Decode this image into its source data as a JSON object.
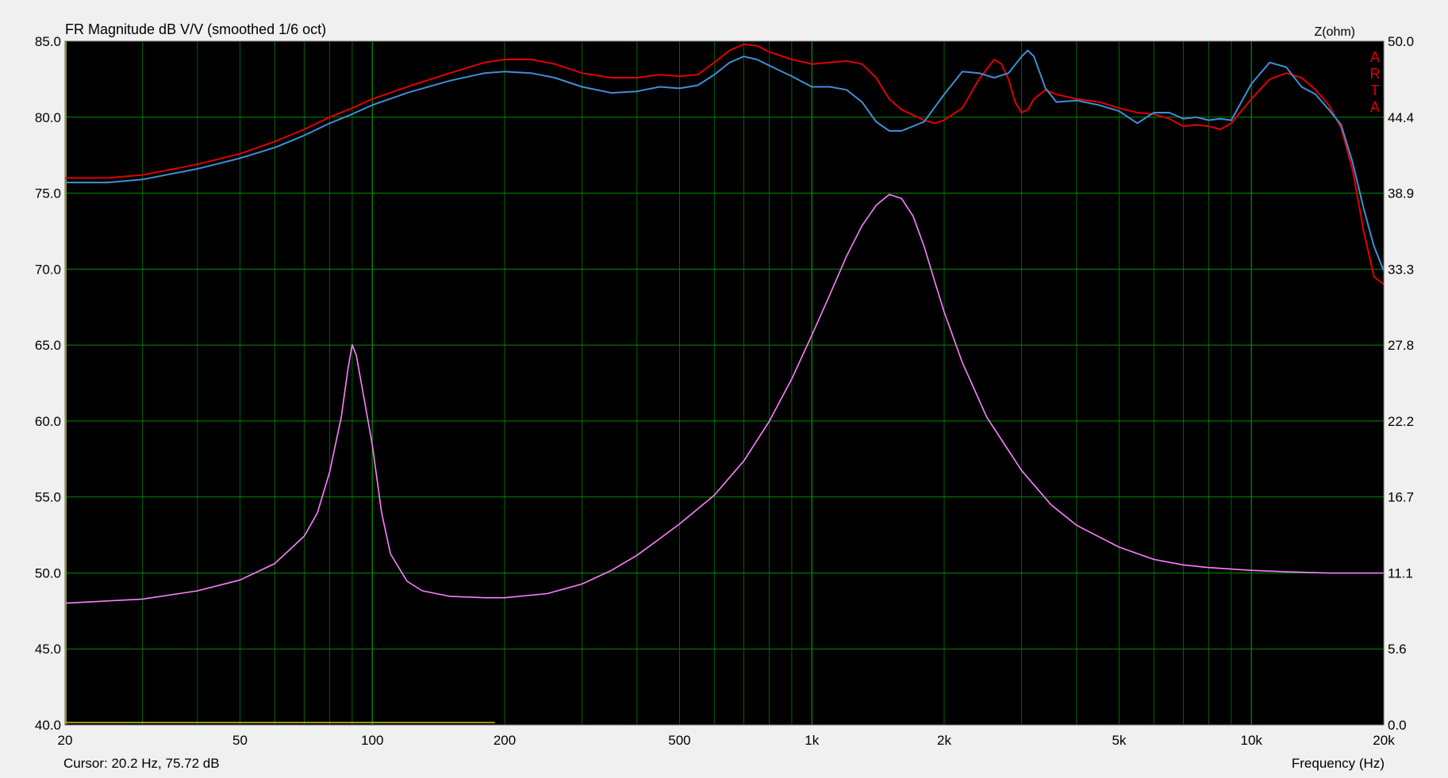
{
  "chart_data": {
    "type": "line",
    "title": "FR Magnitude dB V/V (smoothed 1/6 oct)",
    "xlabel": "Frequency (Hz)",
    "ylabel_left": "",
    "ylabel_right": "Z(ohm)",
    "watermark": "ARTA",
    "cursor_readout": "Cursor: 20.2 Hz, 75.72 dB",
    "x_scale": "log",
    "xlim": [
      20,
      20000
    ],
    "ylim_left": [
      40,
      85
    ],
    "ylim_right": [
      0,
      50
    ],
    "grid": true,
    "x_ticks": [
      {
        "value": 20,
        "label": "20"
      },
      {
        "value": 50,
        "label": "50"
      },
      {
        "value": 100,
        "label": "100"
      },
      {
        "value": 200,
        "label": "200"
      },
      {
        "value": 500,
        "label": "500"
      },
      {
        "value": 1000,
        "label": "1k"
      },
      {
        "value": 2000,
        "label": "2k"
      },
      {
        "value": 5000,
        "label": "5k"
      },
      {
        "value": 10000,
        "label": "10k"
      },
      {
        "value": 20000,
        "label": "20k"
      }
    ],
    "y_left_ticks": [
      "40.0",
      "45.0",
      "50.0",
      "55.0",
      "60.0",
      "65.0",
      "70.0",
      "75.0",
      "80.0",
      "85.0"
    ],
    "y_right_ticks": [
      "0.0",
      "5.6",
      "11.1",
      "16.7",
      "22.2",
      "27.8",
      "33.3",
      "38.9",
      "44.4",
      "50.0"
    ],
    "series": [
      {
        "axis": "left",
        "color": "#e00000",
        "points": [
          [
            20,
            76.0
          ],
          [
            25,
            76.0
          ],
          [
            30,
            76.2
          ],
          [
            40,
            76.9
          ],
          [
            50,
            77.6
          ],
          [
            60,
            78.4
          ],
          [
            70,
            79.2
          ],
          [
            80,
            80.0
          ],
          [
            90,
            80.6
          ],
          [
            100,
            81.2
          ],
          [
            120,
            82.0
          ],
          [
            150,
            82.9
          ],
          [
            180,
            83.6
          ],
          [
            200,
            83.8
          ],
          [
            230,
            83.8
          ],
          [
            260,
            83.5
          ],
          [
            300,
            82.9
          ],
          [
            350,
            82.6
          ],
          [
            400,
            82.6
          ],
          [
            450,
            82.8
          ],
          [
            500,
            82.7
          ],
          [
            550,
            82.8
          ],
          [
            600,
            83.6
          ],
          [
            650,
            84.4
          ],
          [
            700,
            84.8
          ],
          [
            750,
            84.7
          ],
          [
            800,
            84.3
          ],
          [
            900,
            83.8
          ],
          [
            1000,
            83.5
          ],
          [
            1100,
            83.6
          ],
          [
            1200,
            83.7
          ],
          [
            1300,
            83.5
          ],
          [
            1400,
            82.6
          ],
          [
            1500,
            81.2
          ],
          [
            1600,
            80.5
          ],
          [
            1800,
            79.8
          ],
          [
            1900,
            79.6
          ],
          [
            2000,
            79.8
          ],
          [
            2200,
            80.6
          ],
          [
            2400,
            82.5
          ],
          [
            2600,
            83.8
          ],
          [
            2700,
            83.5
          ],
          [
            2800,
            82.5
          ],
          [
            2900,
            81.0
          ],
          [
            3000,
            80.3
          ],
          [
            3100,
            80.5
          ],
          [
            3200,
            81.2
          ],
          [
            3400,
            81.8
          ],
          [
            3600,
            81.5
          ],
          [
            4000,
            81.2
          ],
          [
            4500,
            81.0
          ],
          [
            5000,
            80.6
          ],
          [
            5500,
            80.3
          ],
          [
            6000,
            80.2
          ],
          [
            6500,
            79.9
          ],
          [
            7000,
            79.4
          ],
          [
            7500,
            79.5
          ],
          [
            8000,
            79.4
          ],
          [
            8500,
            79.2
          ],
          [
            9000,
            79.6
          ],
          [
            10000,
            81.2
          ],
          [
            11000,
            82.5
          ],
          [
            12000,
            82.9
          ],
          [
            13000,
            82.6
          ],
          [
            14000,
            81.8
          ],
          [
            15000,
            80.8
          ],
          [
            16000,
            79.3
          ],
          [
            17000,
            76.5
          ],
          [
            18000,
            72.5
          ],
          [
            19000,
            69.5
          ],
          [
            20000,
            69.0
          ]
        ]
      },
      {
        "axis": "left",
        "color": "#3f8fd6",
        "points": [
          [
            20,
            75.7
          ],
          [
            25,
            75.7
          ],
          [
            30,
            75.9
          ],
          [
            40,
            76.6
          ],
          [
            50,
            77.3
          ],
          [
            60,
            78.0
          ],
          [
            70,
            78.8
          ],
          [
            80,
            79.6
          ],
          [
            90,
            80.2
          ],
          [
            100,
            80.8
          ],
          [
            120,
            81.6
          ],
          [
            150,
            82.4
          ],
          [
            180,
            82.9
          ],
          [
            200,
            83.0
          ],
          [
            230,
            82.9
          ],
          [
            260,
            82.6
          ],
          [
            300,
            82.0
          ],
          [
            350,
            81.6
          ],
          [
            400,
            81.7
          ],
          [
            450,
            82.0
          ],
          [
            500,
            81.9
          ],
          [
            550,
            82.1
          ],
          [
            600,
            82.8
          ],
          [
            650,
            83.6
          ],
          [
            700,
            84.0
          ],
          [
            750,
            83.8
          ],
          [
            800,
            83.4
          ],
          [
            900,
            82.7
          ],
          [
            1000,
            82.0
          ],
          [
            1100,
            82.0
          ],
          [
            1200,
            81.8
          ],
          [
            1300,
            81.0
          ],
          [
            1400,
            79.7
          ],
          [
            1500,
            79.1
          ],
          [
            1600,
            79.1
          ],
          [
            1800,
            79.7
          ],
          [
            2000,
            81.5
          ],
          [
            2200,
            83.0
          ],
          [
            2400,
            82.9
          ],
          [
            2600,
            82.6
          ],
          [
            2800,
            82.9
          ],
          [
            3000,
            84.0
          ],
          [
            3100,
            84.4
          ],
          [
            3200,
            84.0
          ],
          [
            3400,
            81.9
          ],
          [
            3600,
            81.0
          ],
          [
            4000,
            81.1
          ],
          [
            4500,
            80.8
          ],
          [
            5000,
            80.4
          ],
          [
            5500,
            79.6
          ],
          [
            6000,
            80.3
          ],
          [
            6500,
            80.3
          ],
          [
            7000,
            79.9
          ],
          [
            7500,
            80.0
          ],
          [
            8000,
            79.8
          ],
          [
            8500,
            79.9
          ],
          [
            9000,
            79.8
          ],
          [
            10000,
            82.2
          ],
          [
            11000,
            83.6
          ],
          [
            12000,
            83.3
          ],
          [
            13000,
            82.0
          ],
          [
            14000,
            81.5
          ],
          [
            15000,
            80.5
          ],
          [
            16000,
            79.5
          ],
          [
            17000,
            77.0
          ],
          [
            18000,
            74.0
          ],
          [
            19000,
            71.5
          ],
          [
            20000,
            69.9
          ]
        ]
      },
      {
        "axis": "right",
        "color": "#ff80ff",
        "points": [
          [
            20,
            8.9
          ],
          [
            30,
            9.2
          ],
          [
            40,
            9.8
          ],
          [
            50,
            10.6
          ],
          [
            60,
            11.8
          ],
          [
            70,
            13.8
          ],
          [
            75,
            15.5
          ],
          [
            80,
            18.5
          ],
          [
            85,
            22.5
          ],
          [
            88,
            26.0
          ],
          [
            90,
            27.8
          ],
          [
            92,
            27.0
          ],
          [
            95,
            24.5
          ],
          [
            100,
            20.5
          ],
          [
            105,
            15.5
          ],
          [
            110,
            12.5
          ],
          [
            120,
            10.5
          ],
          [
            130,
            9.8
          ],
          [
            150,
            9.4
          ],
          [
            180,
            9.3
          ],
          [
            200,
            9.3
          ],
          [
            250,
            9.6
          ],
          [
            300,
            10.3
          ],
          [
            350,
            11.3
          ],
          [
            400,
            12.4
          ],
          [
            450,
            13.6
          ],
          [
            500,
            14.7
          ],
          [
            600,
            16.8
          ],
          [
            700,
            19.3
          ],
          [
            800,
            22.2
          ],
          [
            900,
            25.3
          ],
          [
            1000,
            28.5
          ],
          [
            1100,
            31.5
          ],
          [
            1200,
            34.3
          ],
          [
            1300,
            36.5
          ],
          [
            1400,
            38.0
          ],
          [
            1500,
            38.8
          ],
          [
            1600,
            38.5
          ],
          [
            1700,
            37.2
          ],
          [
            1800,
            35.0
          ],
          [
            1900,
            32.5
          ],
          [
            2000,
            30.2
          ],
          [
            2200,
            26.5
          ],
          [
            2500,
            22.5
          ],
          [
            3000,
            18.6
          ],
          [
            3500,
            16.1
          ],
          [
            4000,
            14.6
          ],
          [
            5000,
            13.0
          ],
          [
            6000,
            12.1
          ],
          [
            7000,
            11.7
          ],
          [
            8000,
            11.5
          ],
          [
            10000,
            11.3
          ],
          [
            12000,
            11.2
          ],
          [
            15000,
            11.1
          ],
          [
            20000,
            11.1
          ]
        ]
      }
    ]
  }
}
